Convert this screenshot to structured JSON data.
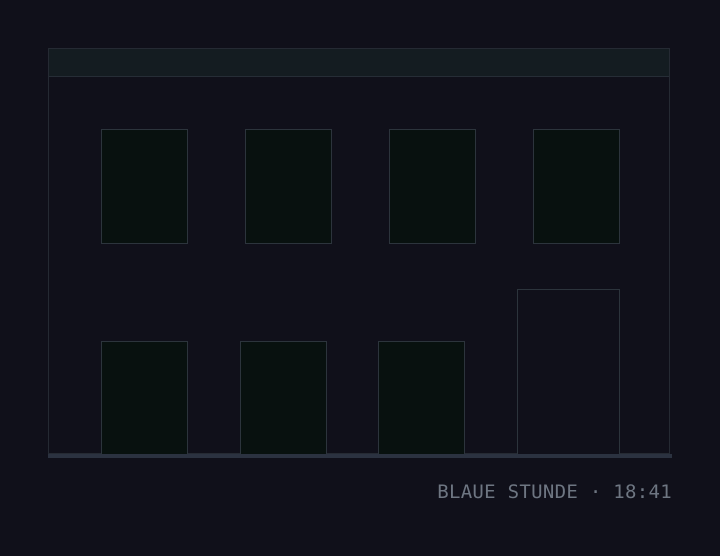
{
  "scene": {
    "caption": "BLAUE STUNDE · 18:41",
    "colors": {
      "background": "#10101a",
      "window_glass": "#08110f",
      "frame_line": "#2c343c",
      "cornice": "#141c21",
      "ground": "#2b3240",
      "caption": "#6e7682"
    },
    "upper_windows": 4,
    "lower_windows": 3,
    "doors": 1
  }
}
